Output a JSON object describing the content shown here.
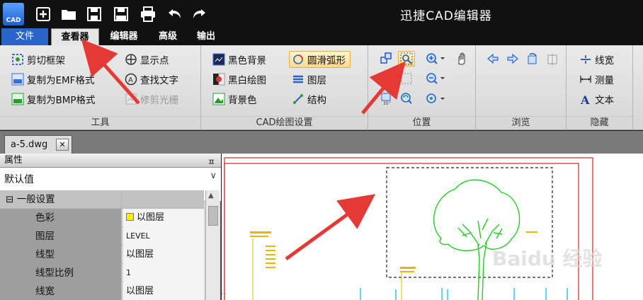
{
  "app": {
    "title": "迅捷CAD编辑器",
    "logo_text": "CAD"
  },
  "menu": {
    "tabs": [
      {
        "label": "文件"
      },
      {
        "label": "查看器"
      },
      {
        "label": "编辑器"
      },
      {
        "label": "高级"
      },
      {
        "label": "输出"
      }
    ]
  },
  "ribbon": {
    "tools": {
      "label": "工具",
      "items": [
        "剪切框架",
        "复制为EMF格式",
        "复制为BMP格式",
        "显示点",
        "查找文字",
        "修剪光栅"
      ]
    },
    "cad_settings": {
      "label": "CAD绘图设置",
      "items": [
        "黑色背景",
        "黑白绘图",
        "背景色",
        "圆滑弧形",
        "图层",
        "结构"
      ]
    },
    "position": {
      "label": "位置"
    },
    "browse": {
      "label": "浏览"
    },
    "hide": {
      "label": "隐藏",
      "items": [
        "线宽",
        "测量",
        "文本"
      ]
    }
  },
  "document": {
    "tab_label": "a-5.dwg",
    "close_glyph": "✕"
  },
  "properties": {
    "header": "属性",
    "pin_glyph": "ㅍ",
    "selected": "默认值",
    "dropdown_glyph": "∨",
    "scroll_up_glyph": "▲",
    "group": {
      "toggle": "⊟",
      "label": "一般设置"
    },
    "rows": [
      {
        "name": "色彩",
        "value": "以图层"
      },
      {
        "name": "图层",
        "value": "LEVEL"
      },
      {
        "name": "线型",
        "value": "以图层"
      },
      {
        "name": "线型比例",
        "value": "1"
      },
      {
        "name": "线宽",
        "value": "以图层"
      }
    ]
  },
  "watermark": "Baidu 经验",
  "colors": {
    "accent_blue": "#2a64c8",
    "drawing_red": "#e02020",
    "drawing_green": "#22cc22",
    "annotation_arrow": "#e53935",
    "color_swatch": "#ffee00"
  }
}
